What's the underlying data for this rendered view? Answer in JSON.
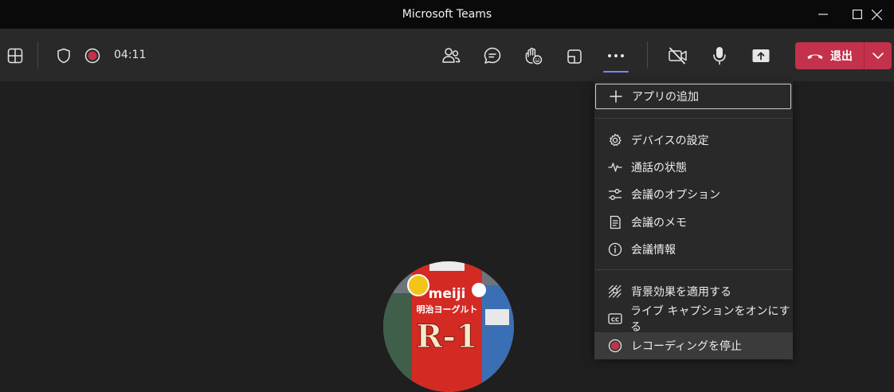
{
  "window": {
    "title": "Microsoft Teams",
    "controls": [
      "minimize-icon",
      "maximize-icon",
      "close-icon"
    ]
  },
  "toolbar": {
    "timer": "04:11",
    "left_icons": [
      "grid-layout-icon",
      "shield-icon",
      "recording-indicator-icon"
    ],
    "right_icons": [
      "people-icon",
      "chat-icon",
      "raise-hand-icon",
      "rooms-icon",
      "more-icon"
    ],
    "media_icons": [
      "camera-off-icon",
      "microphone-icon",
      "share-screen-icon"
    ],
    "leave_label": "退出"
  },
  "more_menu": {
    "items": [
      {
        "label": "アプリの追加",
        "icon": "plus-icon"
      },
      {
        "label": "デバイスの設定",
        "icon": "gear-icon"
      },
      {
        "label": "通話の状態",
        "icon": "pulse-icon"
      },
      {
        "label": "会議のオプション",
        "icon": "sliders-icon"
      },
      {
        "label": "会議のメモ",
        "icon": "notes-icon"
      },
      {
        "label": "会議情報",
        "icon": "info-icon"
      },
      {
        "label": "背景効果を適用する",
        "icon": "background-effects-icon"
      },
      {
        "label": "ライブ キャプションをオンにする",
        "icon": "closed-caption-icon"
      },
      {
        "label": "レコーディングを停止",
        "icon": "stop-recording-icon"
      }
    ]
  },
  "avatar": {
    "product_text": [
      "meiji",
      "明治ヨーグルト",
      "R-1"
    ]
  },
  "colors": {
    "accent": "#7f85f5",
    "leave": "#c4314b",
    "record": "#c4314b",
    "toolbar_bg": "#292929",
    "menu_bg": "#292929",
    "stage_bg": "#1f1f1f",
    "titlebar_bg": "#0a0a0a"
  }
}
